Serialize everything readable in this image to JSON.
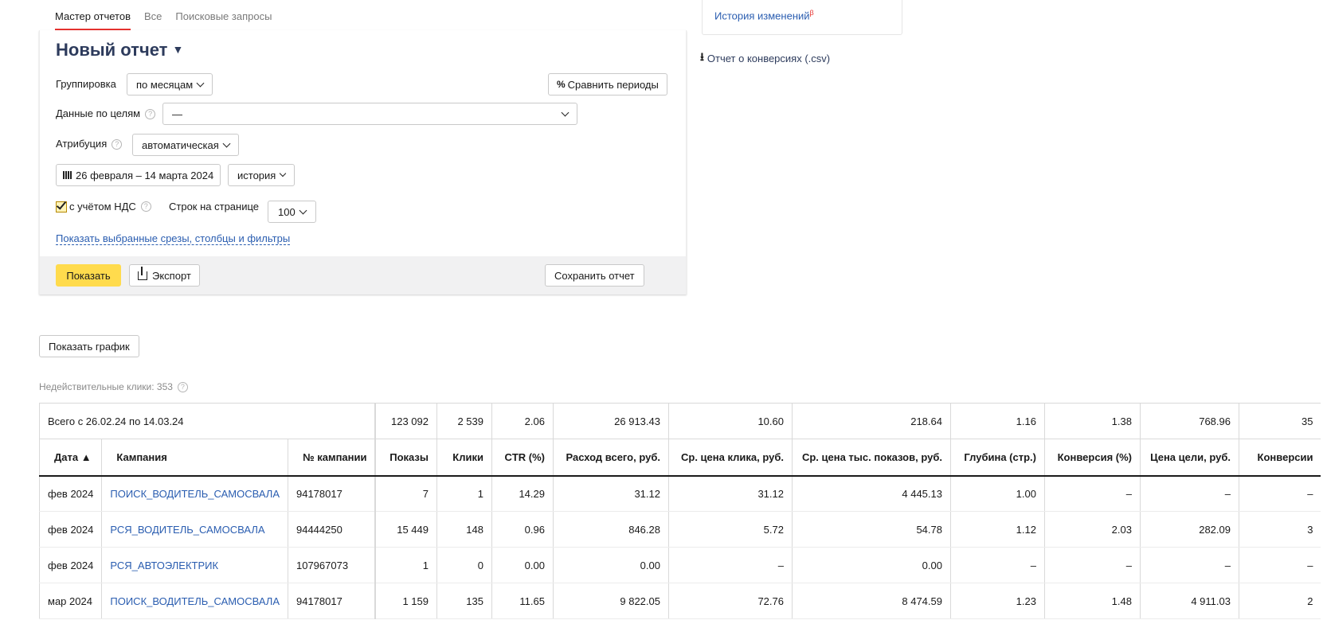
{
  "tabs": [
    "Мастер отчетов",
    "Все",
    "Поисковые запросы"
  ],
  "report": {
    "title": "Новый отчет",
    "grouping_label": "Группировка",
    "grouping_value": "по месяцам",
    "compare_button": "Сравнить периоды",
    "goals_label": "Данные по целям",
    "goals_value": "—",
    "attribution_label": "Атрибуция",
    "attribution_value": "автоматическая",
    "date_range": "26 февраля – 14 марта 2024",
    "history_select": "история",
    "vat_label": "с учётом НДС",
    "vat_checked": true,
    "rows_label": "Строк на странице",
    "rows_value": "100",
    "show_filters_link": "Показать выбранные срезы, столбцы и фильтры",
    "show_button": "Показать",
    "export_button": "Экспорт",
    "save_button": "Сохранить отчет"
  },
  "sidebar": {
    "history_link": "История изменений",
    "history_badge": "β",
    "conversions_link": "Отчет о конверсиях (.csv)"
  },
  "show_chart_button": "Показать график",
  "invalid_clicks": "Недействительные клики: 353",
  "table": {
    "totals": {
      "label": "Всего с 26.02.24 по 14.03.24",
      "values": [
        "123 092",
        "2 539",
        "2.06",
        "26 913.43",
        "10.60",
        "218.64",
        "1.16",
        "1.38",
        "768.96",
        "35"
      ]
    },
    "headers": [
      "Дата ▲",
      "Кампания",
      "№ кампании",
      "Показы",
      "Клики",
      "CTR (%)",
      "Расход всего, руб.",
      "Ср. цена клика, руб.",
      "Ср. цена тыс. показов, руб.",
      "Глубина (стр.)",
      "Конверсия (%)",
      "Цена цели, руб.",
      "Конверсии"
    ],
    "rows": [
      [
        "фев 2024",
        "ПОИСК_ВОДИТЕЛЬ_САМОСВАЛА",
        "94178017",
        "7",
        "1",
        "14.29",
        "31.12",
        "31.12",
        "4 445.13",
        "1.00",
        "–",
        "–",
        "–"
      ],
      [
        "фев 2024",
        "РСЯ_ВОДИТЕЛЬ_САМОСВАЛА",
        "94444250",
        "15 449",
        "148",
        "0.96",
        "846.28",
        "5.72",
        "54.78",
        "1.12",
        "2.03",
        "282.09",
        "3"
      ],
      [
        "фев 2024",
        "РСЯ_АВТОЭЛЕКТРИК",
        "107967073",
        "1",
        "0",
        "0.00",
        "0.00",
        "–",
        "0.00",
        "–",
        "–",
        "–",
        "–"
      ],
      [
        "мар 2024",
        "ПОИСК_ВОДИТЕЛЬ_САМОСВАЛА",
        "94178017",
        "1 159",
        "135",
        "11.65",
        "9 822.05",
        "72.76",
        "8 474.59",
        "1.23",
        "1.48",
        "4 911.03",
        "2"
      ]
    ]
  }
}
